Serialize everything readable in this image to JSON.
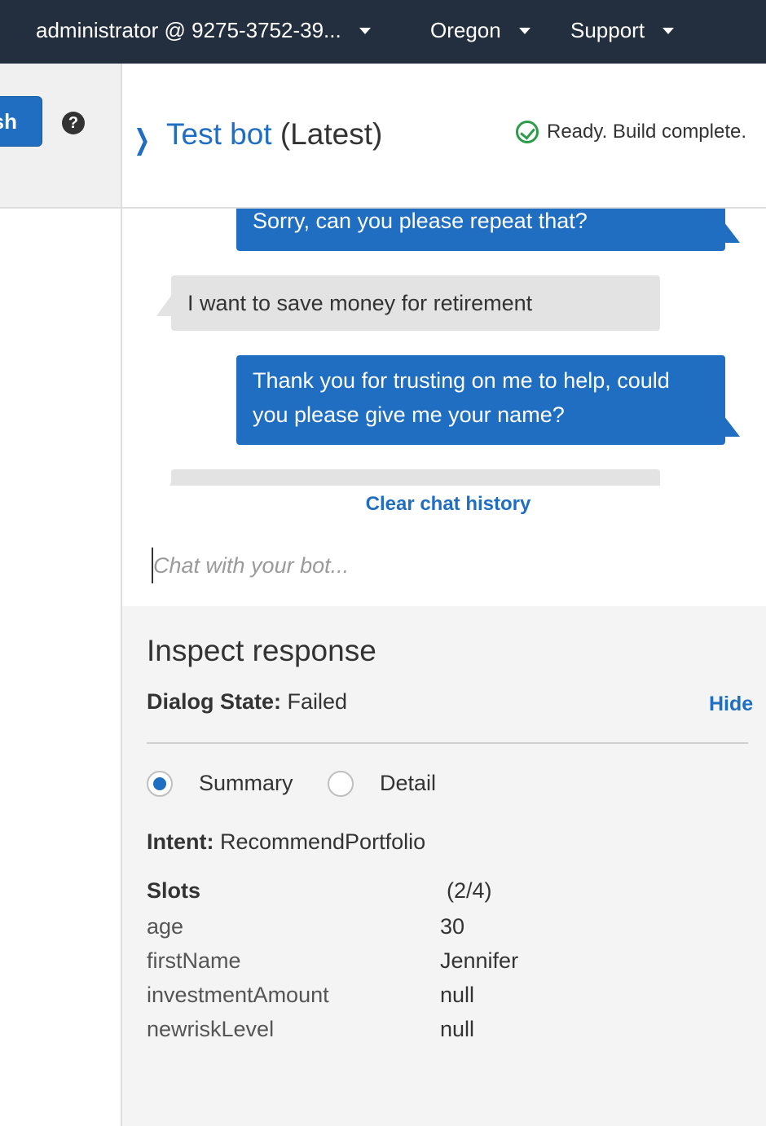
{
  "topbar": {
    "account": "administrator @ 9275-3752-39...",
    "region": "Oregon",
    "support": "Support"
  },
  "sidebar": {
    "publish_label": "sh",
    "help_icon": "?"
  },
  "test_bot": {
    "title": "Test bot",
    "version": " (Latest)",
    "status": "Ready. Build complete."
  },
  "chat": {
    "messages": [
      {
        "from": "bot",
        "text": "Sorry, can you please repeat that?"
      },
      {
        "from": "user",
        "text": "I want to save money for retirement"
      },
      {
        "from": "bot",
        "text": "Thank you for trusting on me to help, could you please give me your name?"
      },
      {
        "from": "user",
        "text": ""
      }
    ],
    "clear_label": "Clear chat history",
    "input_placeholder": "Chat with your bot..."
  },
  "inspect": {
    "title": "Inspect response",
    "dialog_state_label": "Dialog State:",
    "dialog_state_value": " Failed",
    "hide_label": "Hide",
    "view_options": [
      {
        "label": "Summary",
        "selected": true
      },
      {
        "label": "Detail",
        "selected": false
      }
    ],
    "intent_label": "Intent:",
    "intent_value": " RecommendPortfolio",
    "slots_label": "Slots",
    "slots_count": "(2/4)",
    "slots": [
      {
        "name": "age",
        "value": "30"
      },
      {
        "name": "firstName",
        "value": "Jennifer"
      },
      {
        "name": "investmentAmount",
        "value": "null"
      },
      {
        "name": "newriskLevel",
        "value": "null"
      }
    ]
  },
  "colors": {
    "accent": "#1f6ec2",
    "topbar": "#232f3e",
    "success": "#2d9c4a"
  }
}
